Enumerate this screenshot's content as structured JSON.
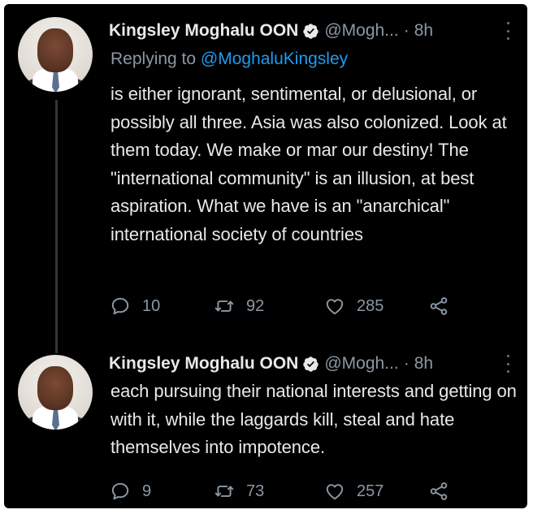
{
  "tweets": [
    {
      "name": "Kingsley Moghalu OON",
      "handle": "@Mogh...",
      "separator": "·",
      "time": "8h",
      "replying_prefix": "Replying to",
      "replying_to": "@MoghaluKingsley",
      "text": "is either ignorant, sentimental, or delusional, or possibly all three. Asia was also colonized. Look at them today. We make or mar our destiny! The \"international community\" is an illusion, at best aspiration. What we have is an \"anarchical\" international society of countries",
      "replies": "10",
      "retweets": "92",
      "likes": "285"
    },
    {
      "name": "Kingsley Moghalu OON",
      "handle": "@Mogh...",
      "separator": "·",
      "time": "8h",
      "text": "each pursuing their national interests and getting on with it, while the laggards kill, steal and hate themselves into impotence.",
      "replies": "9",
      "retweets": "73",
      "likes": "257"
    }
  ],
  "icons": {
    "verified": "verified-badge-icon",
    "more": "more-vertical-icon",
    "reply": "reply-icon",
    "retweet": "retweet-icon",
    "like": "heart-icon",
    "share": "share-icon"
  },
  "colors": {
    "background": "#000000",
    "text": "#e7e9ea",
    "muted": "#8b98a5",
    "link": "#1d9bf0"
  }
}
